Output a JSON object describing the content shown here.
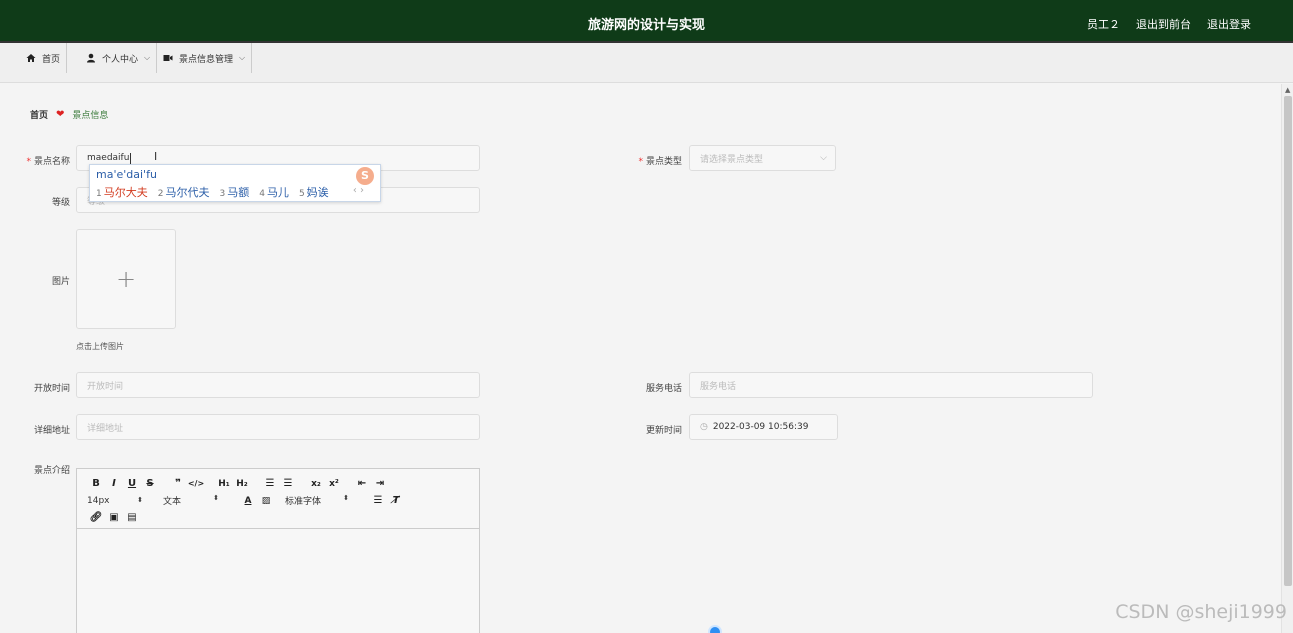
{
  "header": {
    "title": "旅游网的设计与实现",
    "user": "员工２",
    "goto_front": "退出到前台",
    "logout": "退出登录"
  },
  "nav": {
    "home": "首页",
    "personal": "个人中心",
    "spot_manage": "景点信息管理"
  },
  "breadcrumb": {
    "home": "首页",
    "current": "景点信息"
  },
  "form": {
    "name_label": "景点名称",
    "name_value": "maedaifu",
    "type_label": "景点类型",
    "type_placeholder": "请选择景点类型",
    "level_label": "等级",
    "level_placeholder": "等级",
    "image_label": "图片",
    "upload_tip": "点击上传图片",
    "open_time_label": "开放时间",
    "open_time_placeholder": "开放时间",
    "phone_label": "服务电话",
    "phone_placeholder": "服务电话",
    "address_label": "详细地址",
    "address_placeholder": "详细地址",
    "update_time_label": "更新时间",
    "update_time_value": "2022-03-09 10:56:39",
    "intro_label": "景点介绍"
  },
  "ime": {
    "pinyin": "ma'e'dai'fu",
    "candidates": [
      {
        "num": "1",
        "text": "马尔大夫"
      },
      {
        "num": "2",
        "text": "马尔代夫"
      },
      {
        "num": "3",
        "text": "马额"
      },
      {
        "num": "4",
        "text": "马儿"
      },
      {
        "num": "5",
        "text": "妈诶"
      }
    ]
  },
  "editor": {
    "font_size": "14px",
    "text_type": "文本",
    "font_family": "标准字体"
  },
  "watermark": "CSDN @sheji1999"
}
